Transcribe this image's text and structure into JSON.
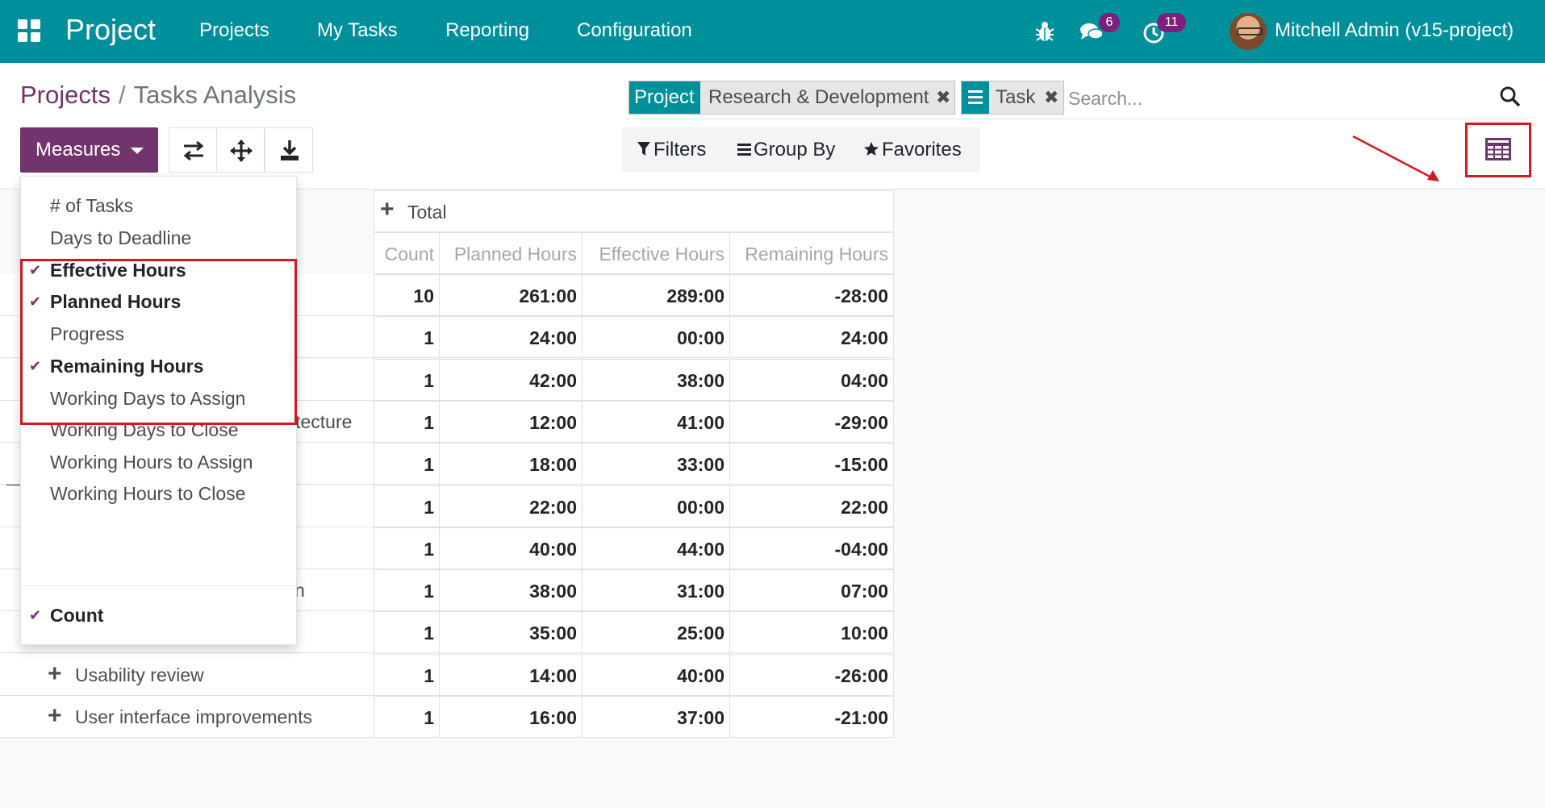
{
  "navbar": {
    "brand": "Project",
    "menu": [
      "Projects",
      "My Tasks",
      "Reporting",
      "Configuration"
    ],
    "messages_count": "6",
    "activities_count": "11",
    "user": "Mitchell Admin (v15-project)"
  },
  "breadcrumb": {
    "parent": "Projects",
    "separator": "/",
    "current": "Tasks Analysis"
  },
  "search": {
    "facets": [
      {
        "type": "Project",
        "value": "Research & Development"
      },
      {
        "type": "group-by-icon",
        "value": "Task"
      }
    ],
    "placeholder": "Search..."
  },
  "buttons": {
    "measures": "Measures"
  },
  "filterbar": {
    "filters": "Filters",
    "group_by": "Group By",
    "favorites": "Favorites"
  },
  "measures_menu": {
    "items": [
      {
        "label": "# of Tasks",
        "selected": false
      },
      {
        "label": "Days to Deadline",
        "selected": false
      },
      {
        "label": "Effective Hours",
        "selected": true
      },
      {
        "label": "Planned Hours",
        "selected": true
      },
      {
        "label": "Progress",
        "selected": false
      },
      {
        "label": "Remaining Hours",
        "selected": true
      },
      {
        "label": "Working Days to Assign",
        "selected": false
      },
      {
        "label": "Working Days to Close",
        "selected": false
      },
      {
        "label": "Working Hours to Assign",
        "selected": false
      },
      {
        "label": "Working Hours to Close",
        "selected": false
      }
    ],
    "count": {
      "label": "Count",
      "selected": true
    }
  },
  "pivot": {
    "header_total": "Total",
    "columns": [
      "Count",
      "Planned Hours",
      "Effective Hours",
      "Remaining Hours"
    ],
    "rows": [
      {
        "label": "",
        "values": [
          "10",
          "261:00",
          "289:00",
          "-28:00"
        ]
      },
      {
        "label": "",
        "values": [
          "1",
          "24:00",
          "00:00",
          "24:00"
        ]
      },
      {
        "label": "",
        "values": [
          "1",
          "42:00",
          "38:00",
          "04:00"
        ]
      },
      {
        "label": "itecture",
        "values": [
          "1",
          "12:00",
          "41:00",
          "-29:00"
        ]
      },
      {
        "label": "",
        "values": [
          "1",
          "18:00",
          "33:00",
          "-15:00"
        ]
      },
      {
        "label": "",
        "values": [
          "1",
          "22:00",
          "00:00",
          "22:00"
        ]
      },
      {
        "label": "",
        "values": [
          "1",
          "40:00",
          "44:00",
          "-04:00"
        ]
      },
      {
        "label": "n",
        "values": [
          "1",
          "38:00",
          "31:00",
          "07:00"
        ]
      },
      {
        "label": "",
        "values": [
          "1",
          "35:00",
          "25:00",
          "10:00"
        ]
      },
      {
        "label": "Usability review",
        "values": [
          "1",
          "14:00",
          "40:00",
          "-26:00"
        ]
      },
      {
        "label": "User interface improvements",
        "values": [
          "1",
          "16:00",
          "37:00",
          "-21:00"
        ]
      }
    ]
  },
  "colors": {
    "navbar": "#00909c",
    "primary": "#71346d",
    "highlight": "#d1191f",
    "badge": "#7c1f7e"
  }
}
